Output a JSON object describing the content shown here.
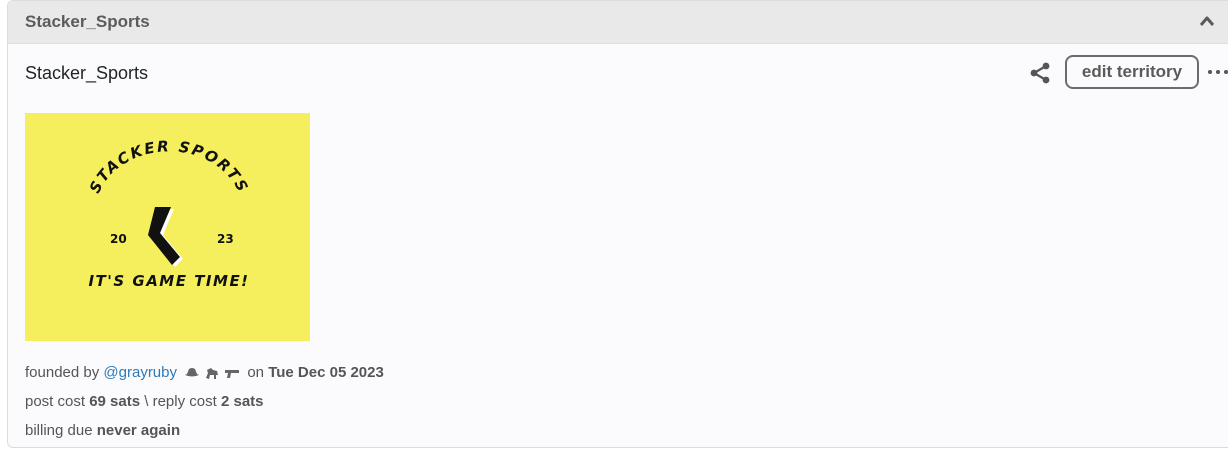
{
  "header": {
    "title": "Stacker_Sports"
  },
  "territory": {
    "name": "Stacker_Sports",
    "edit_label": "edit territory"
  },
  "logo": {
    "arc_text": "STACKER SPORTS",
    "year_left": "20",
    "year_right": "23",
    "tagline": "IT'S GAME TIME!",
    "background": "#f5ef5d"
  },
  "meta": {
    "founded_prefix": "founded by",
    "founder": "@grayruby",
    "badges": [
      "cowboy-hat-icon",
      "horse-icon",
      "gun-icon"
    ],
    "on_label": "on",
    "date": "Tue Dec 05 2023",
    "post_cost_label": "post cost",
    "post_cost": "69 sats",
    "separator": "\\",
    "reply_cost_label": "reply cost",
    "reply_cost": "2 sats",
    "billing_label": "billing due",
    "billing_value": "never again"
  },
  "colors": {
    "link": "#2e7bb8",
    "header_bg": "#e9e9ea"
  }
}
